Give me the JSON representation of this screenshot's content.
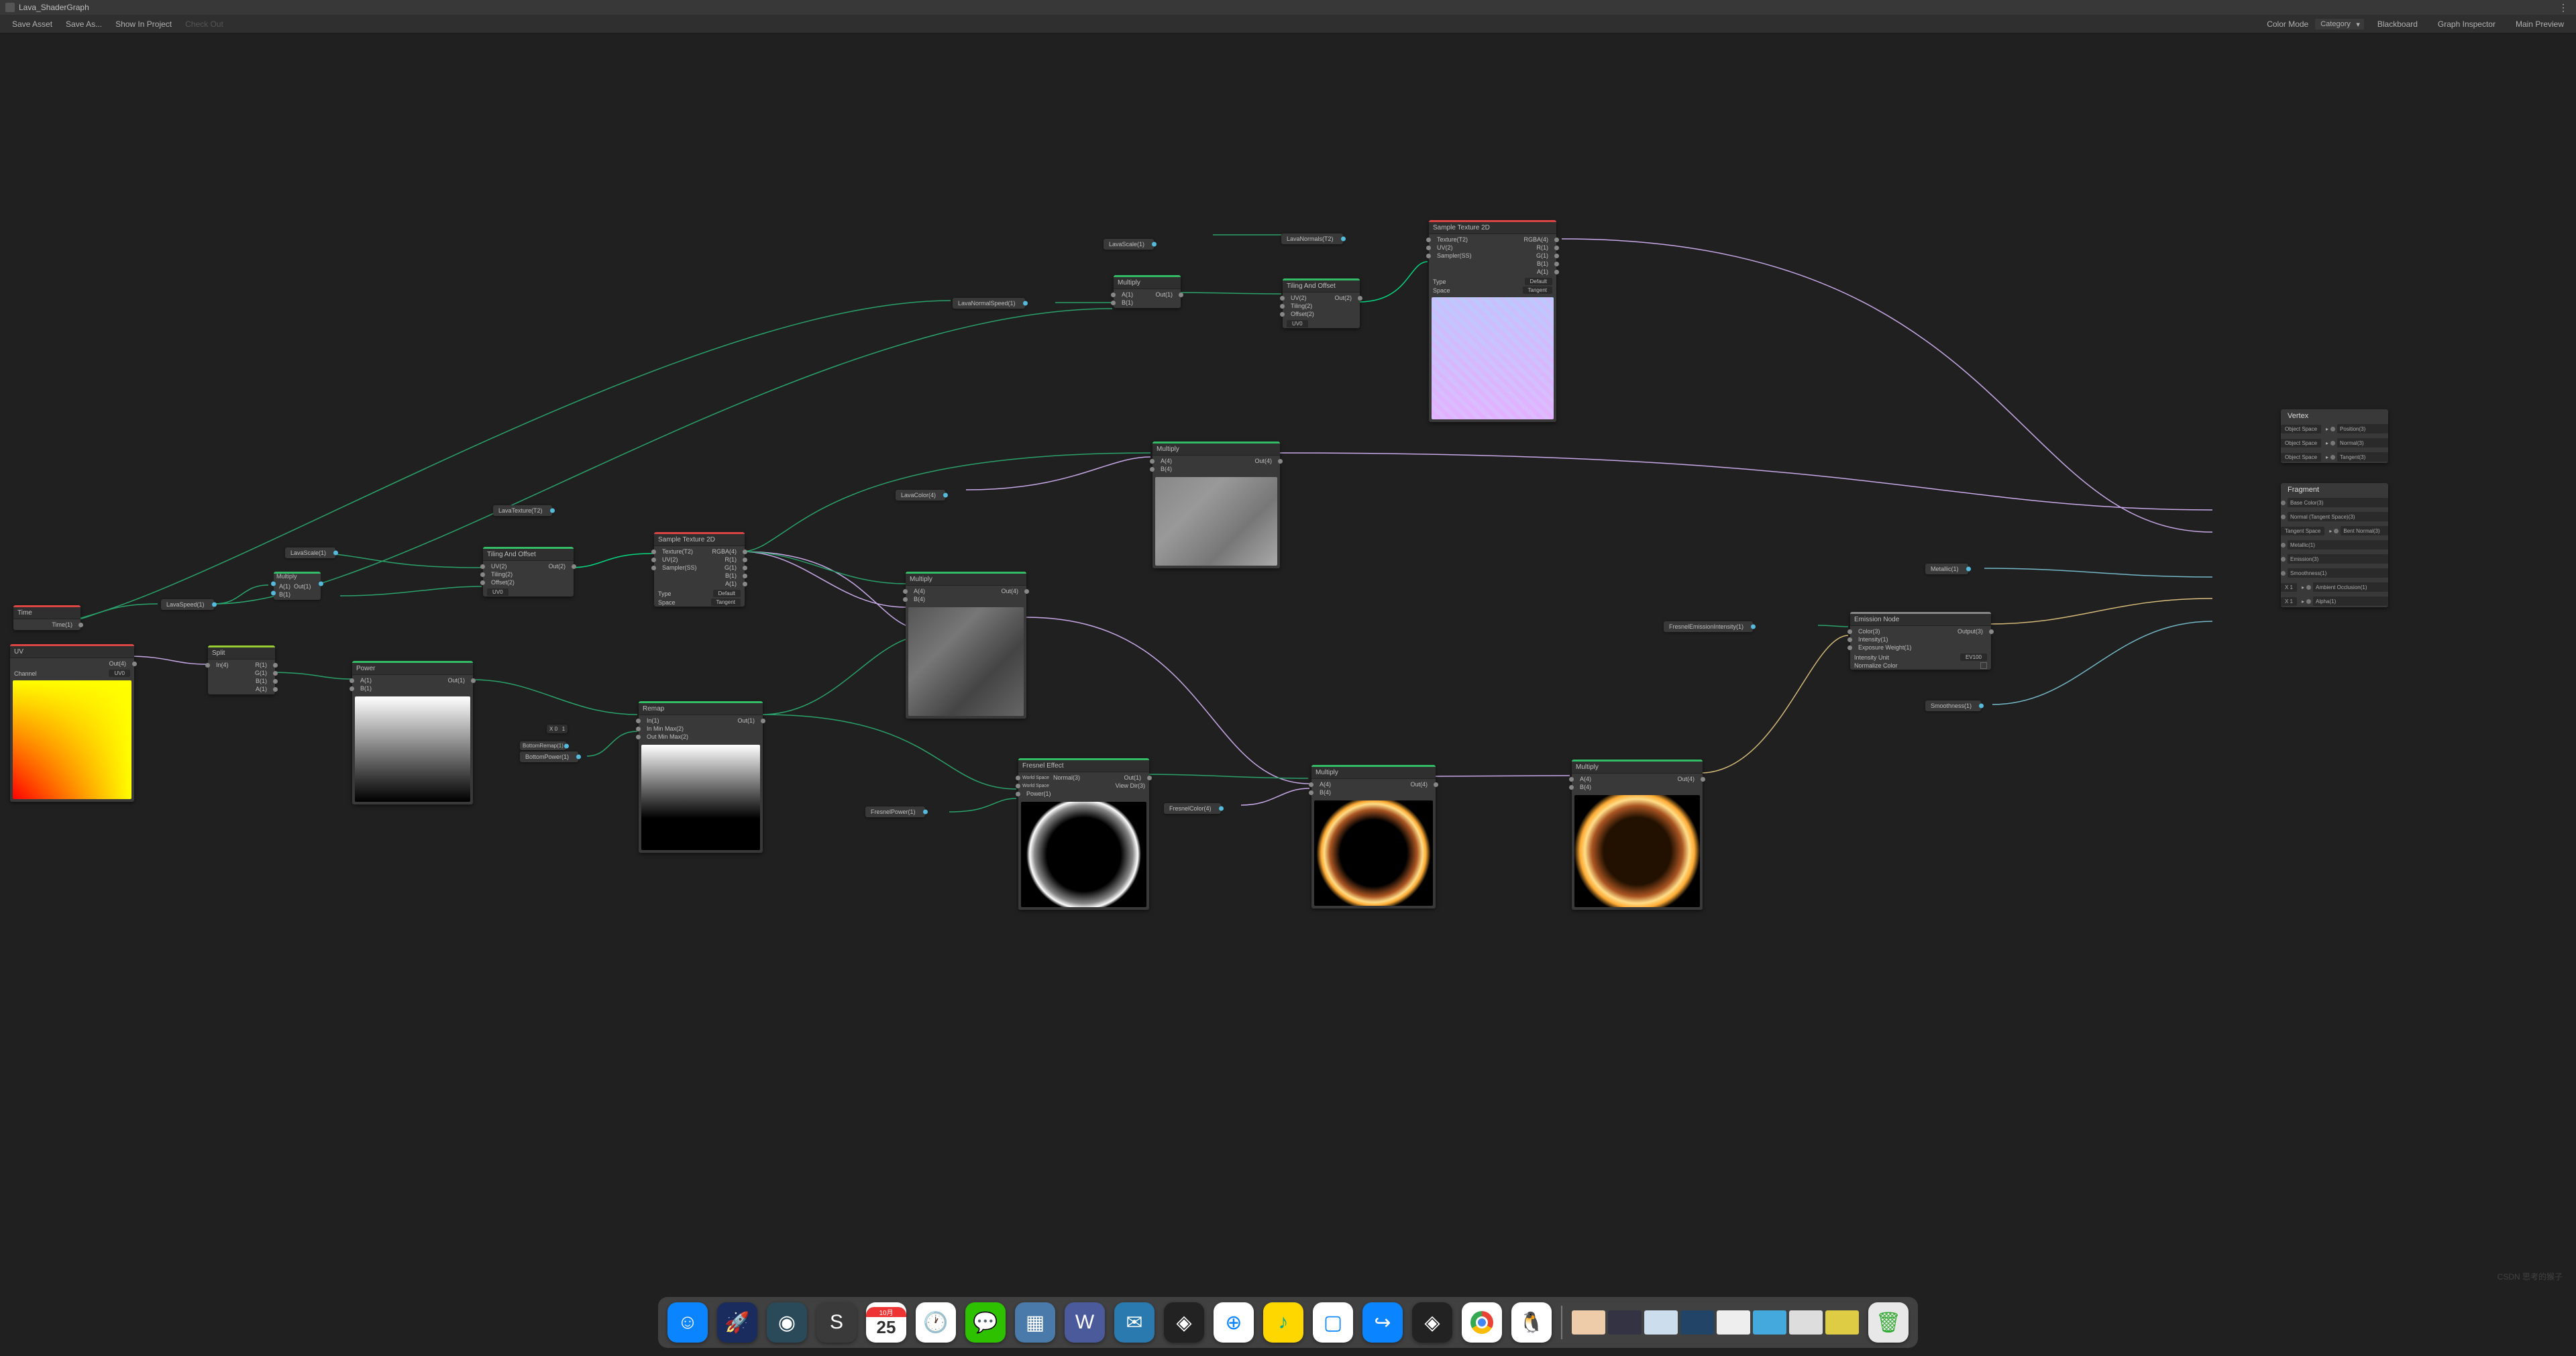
{
  "title": "Lava_ShaderGraph",
  "toolbar": {
    "saveAsset": "Save Asset",
    "saveAs": "Save As...",
    "showInProject": "Show In Project",
    "checkOut": "Check Out",
    "colorMode": "Color Mode",
    "colorModeValue": "Category",
    "blackboard": "Blackboard",
    "graphInspector": "Graph Inspector",
    "mainPreview": "Main Preview"
  },
  "chips": {
    "lavaScale": "LavaScale(1)",
    "lavaNormalSpeed": "LavaNormalSpeed(1)",
    "lavaNormals": "LavaNormals(T2)",
    "lavaColor": "LavaColor(4)",
    "lavaTexture": "LavaTexture(T2)",
    "lavaScale2": "LavaScale(1)",
    "lavaSpeed": "LavaSpeed(1)",
    "bottomPower": "BottomPower(1)",
    "bottomRemap": "BottomRemap(1)",
    "fresnelPower": "FresnelPower(1)",
    "fresnelColor": "FresnelColor(4)",
    "fresnelEmission": "FresnelEmissionIntensity(1)",
    "metallic": "Metallic(1)",
    "smoothness": "Smoothness(1)"
  },
  "nodes": {
    "time": {
      "title": "Time",
      "out": "Time(1)"
    },
    "multiply1": {
      "title": "Multiply",
      "a": "A(1)",
      "b": "B(1)",
      "out": "Out(1)"
    },
    "multiply2": {
      "title": "Multiply",
      "a": "A(1)",
      "b": "B(1)",
      "out": "Out(1)"
    },
    "multiplyTop": {
      "title": "Multiply",
      "a": "A(4)",
      "b": "B(4)",
      "out": "Out(4)"
    },
    "multiplyMid": {
      "title": "Multiply",
      "a": "A(4)",
      "b": "B(4)",
      "out": "Out(4)"
    },
    "multiplyFres": {
      "title": "Multiply",
      "a": "A(4)",
      "b": "B(4)",
      "out": "Out(4)"
    },
    "multiplyFinal": {
      "title": "Multiply",
      "a": "A(4)",
      "b": "B(4)",
      "out": "Out(4)"
    },
    "tiling1": {
      "title": "Tiling And Offset",
      "uv": "UV(2)",
      "tiling": "Tiling(2)",
      "offset": "Offset(2)",
      "out": "Out(2)",
      "uvsel": "UV0"
    },
    "tiling2": {
      "title": "Tiling And Offset",
      "uv": "UV(2)",
      "tiling": "Tiling(2)",
      "offset": "Offset(2)",
      "out": "Out(2)",
      "uvsel": "UV0"
    },
    "sample1": {
      "title": "Sample Texture 2D",
      "tex": "Texture(T2)",
      "uv": "UV(2)",
      "sampler": "Sampler(SS)",
      "rgba": "RGBA(4)",
      "r": "R(1)",
      "g": "G(1)",
      "b": "B(1)",
      "a": "A(1)",
      "type": "Type",
      "typeV": "Default",
      "space": "Space",
      "spaceV": "Tangent"
    },
    "sample2": {
      "title": "Sample Texture 2D",
      "tex": "Texture(T2)",
      "uv": "UV(2)",
      "sampler": "Sampler(SS)",
      "rgba": "RGBA(4)",
      "r": "R(1)",
      "g": "G(1)",
      "b": "B(1)",
      "a": "A(1)",
      "type": "Type",
      "typeV": "Default",
      "space": "Space",
      "spaceV": "Tangent"
    },
    "uv": {
      "title": "UV",
      "out": "Out(4)",
      "channel": "Channel",
      "channelV": "UV0"
    },
    "split": {
      "title": "Split",
      "in": "In(4)",
      "r": "R(1)",
      "g": "G(1)",
      "b": "B(1)",
      "a": "A(1)"
    },
    "power": {
      "title": "Power",
      "a": "A(1)",
      "b": "B(1)",
      "out": "Out(1)"
    },
    "remap": {
      "title": "Remap",
      "in": "In(1)",
      "inMin": "In Min Max(2)",
      "outMin": "Out Min Max(2)",
      "out": "Out(1)"
    },
    "fresnel": {
      "title": "Fresnel Effect",
      "normal": "Normal(3)",
      "view": "View Dir(3)",
      "power": "Power(1)",
      "out": "Out(1)",
      "ws1": "World Space",
      "ws2": "World Space"
    },
    "emission": {
      "title": "Emission Node",
      "color": "Color(3)",
      "intensity": "Intensity(1)",
      "exp": "Exposure Weight(1)",
      "out": "Output(3)",
      "unit": "Intensity Unit",
      "unitV": "EV100",
      "norm": "Normalize Color"
    }
  },
  "remapVals": {
    "x": "X",
    "zero": "0",
    "one": "1"
  },
  "master": {
    "vertex": "Vertex",
    "objSpace": "Object Space",
    "tanSpace": "Tangent Space",
    "pos": "Position(3)",
    "normal": "Normal(3)",
    "tangent": "Tangent(3)",
    "fragment": "Fragment",
    "baseColor": "Base Color(3)",
    "normalTS": "Normal (Tangent Space)(3)",
    "bentNormal": "Bent Normal(3)",
    "metallic": "Metallic(1)",
    "emission": "Emission(3)",
    "smoothness": "Smoothness(1)",
    "ao": "Ambient Occlusion(1)",
    "alpha": "Alpha(1)",
    "x1": "X  1"
  },
  "dock": {
    "date": "25",
    "month": "10月"
  },
  "watermark": "CSDN 思考的猴子"
}
